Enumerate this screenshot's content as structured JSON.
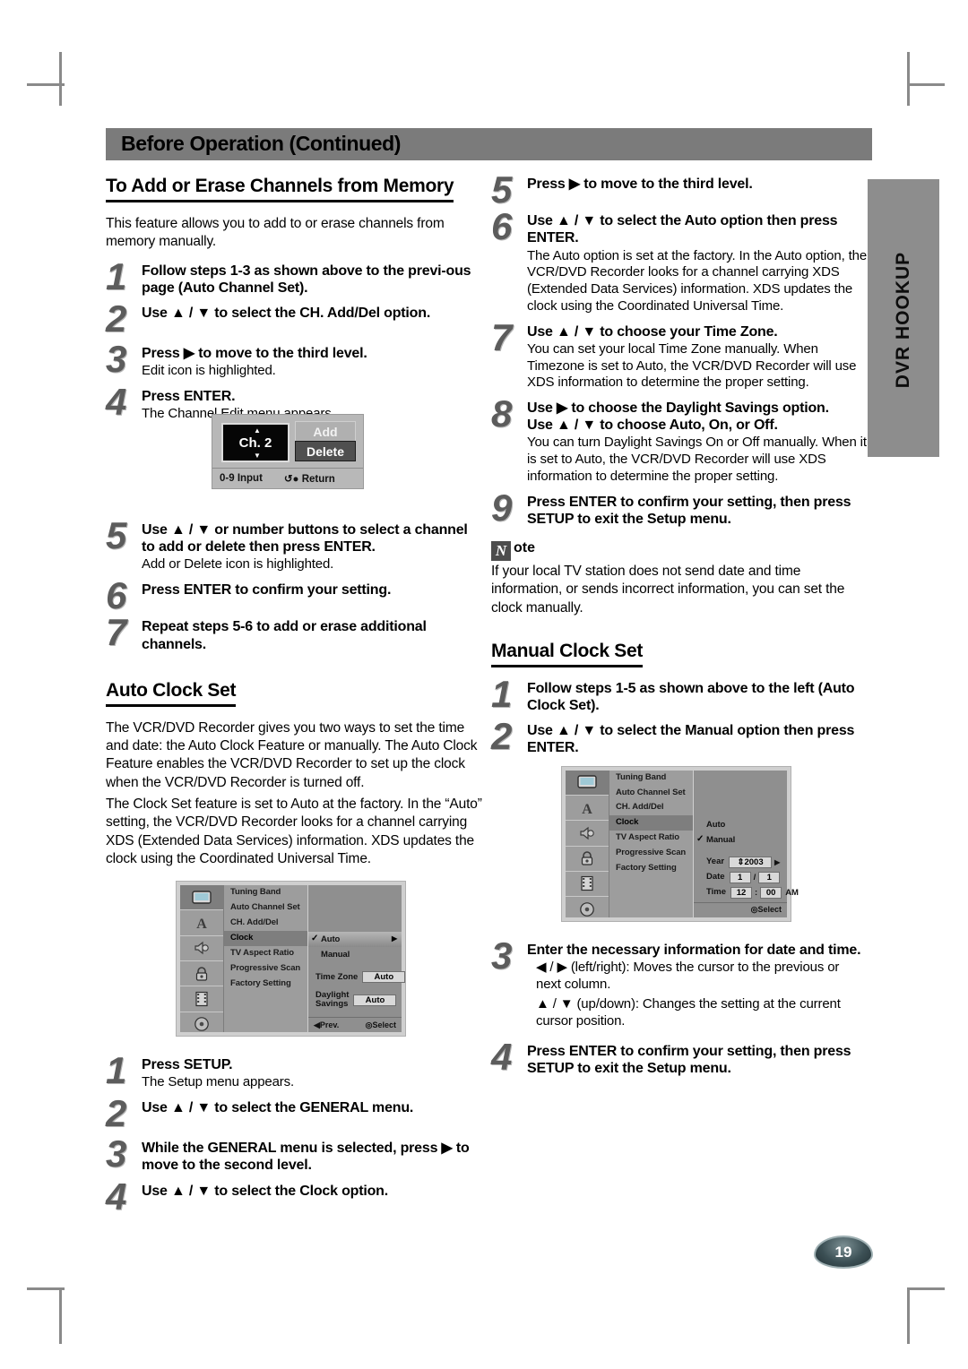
{
  "header": {
    "title": "Before Operation (Continued)"
  },
  "side_tab": {
    "label": "DVR HOOKUP"
  },
  "page_number": "19",
  "left": {
    "section1_title": "To Add or Erase Channels from Memory",
    "intro": "This feature allows you to add to or erase channels from memory manually.",
    "steps": [
      {
        "num": "1",
        "head": "Follow steps 1-3 as shown above to the previ-ous page (Auto Channel Set).",
        "sub": ""
      },
      {
        "num": "2",
        "head": "Use ▲ / ▼ to select the CH. Add/Del option.",
        "sub": ""
      },
      {
        "num": "3",
        "head": "Press ▶ to move to the third level.",
        "sub": "Edit icon is highlighted."
      },
      {
        "num": "4",
        "head": "Press ENTER.",
        "sub": "The Channel Edit menu appears."
      }
    ],
    "chan_edit": {
      "channel": "Ch. 2",
      "add_label": "Add",
      "delete_label": "Delete",
      "footer_left": "0-9 Input",
      "footer_right": "Return"
    },
    "steps2": [
      {
        "num": "5",
        "head": "Use ▲ / ▼ or number buttons to select a channel to add or delete then press ENTER.",
        "sub": "Add or Delete icon is highlighted."
      },
      {
        "num": "6",
        "head": "Press ENTER to confirm your setting.",
        "sub": ""
      },
      {
        "num": "7",
        "head": "Repeat steps 5-6 to add or erase additional channels.",
        "sub": ""
      }
    ],
    "section2_title": "Auto Clock Set",
    "auto_para1": "The VCR/DVD Recorder gives you two ways to set the time and date: the Auto Clock Feature or manually. The Auto Clock Feature enables the VCR/DVD Recorder to set up the clock when the VCR/DVD Recorder is turned off.",
    "auto_para2": "The Clock Set feature is set to Auto at the factory. In the “Auto” setting, the VCR/DVD Recorder looks for a channel carrying XDS (Extended Data Services) information. XDS updates the clock using the Coordinated Universal Time.",
    "osd_auto": {
      "menu_items": [
        "Tuning Band",
        "Auto Channel Set",
        "CH. Add/Del",
        "Clock",
        "TV Aspect Ratio",
        "Progressive Scan",
        "Factory Setting"
      ],
      "selected_menu_item": "Clock",
      "option_auto": "Auto",
      "option_manual": "Manual",
      "timezone_label": "Time Zone",
      "timezone_value": "Auto",
      "daylight_label1": "Daylight",
      "daylight_label2": "Savings",
      "daylight_value": "Auto",
      "bar_prev": "Prev.",
      "bar_select": "Select"
    },
    "steps3": [
      {
        "num": "1",
        "head": "Press SETUP.",
        "sub": "The Setup menu appears."
      },
      {
        "num": "2",
        "head": "Use ▲ / ▼ to select the GENERAL menu.",
        "sub": ""
      },
      {
        "num": "3",
        "head": "While the GENERAL menu is selected, press ▶ to move to the second level.",
        "sub": ""
      },
      {
        "num": "4",
        "head": "Use ▲ / ▼ to select the Clock option.",
        "sub": ""
      }
    ]
  },
  "right": {
    "steps": [
      {
        "num": "5",
        "head": "Press ▶ to move to the third level.",
        "sub": ""
      },
      {
        "num": "6",
        "head": "Use ▲ / ▼ to select the Auto option then press ENTER.",
        "sub": "The Auto option is set at the factory. In the Auto option, the VCR/DVD Recorder looks for a channel carrying XDS (Extended Data Services) information. XDS updates the clock using the Coordinated Universal Time."
      },
      {
        "num": "7",
        "head": "Use ▲ / ▼ to choose your Time Zone.",
        "sub": "You can set your local Time Zone manually. When Timezone is set to Auto, the VCR/DVD Recorder will use XDS information to determine the proper setting."
      },
      {
        "num": "8",
        "head": "Use ▶ to choose the Daylight Savings option.",
        "head2": "Use ▲ / ▼ to choose Auto, On, or Off.",
        "sub": "You can turn Daylight Savings On or Off manually. When it is set to Auto, the VCR/DVD Recorder will use XDS information to determine the proper setting."
      },
      {
        "num": "9",
        "head": "Press ENTER to confirm your setting, then press SETUP to exit the Setup menu.",
        "sub": ""
      }
    ],
    "note_badge": "N",
    "note_word": "ote",
    "note_text": "If your local TV station does not send date and time information, or sends incorrect information, you can set the clock manually.",
    "section_title": "Manual Clock Set",
    "steps2": [
      {
        "num": "1",
        "head": "Follow steps 1-5 as shown above to the left (Auto Clock Set).",
        "sub": ""
      },
      {
        "num": "2",
        "head": "Use ▲ / ▼ to select the Manual option then press ENTER.",
        "sub": ""
      }
    ],
    "osd_manual": {
      "menu_items": [
        "Tuning Band",
        "Auto Channel Set",
        "CH. Add/Del",
        "Clock",
        "TV Aspect Ratio",
        "Progressive Scan",
        "Factory Setting"
      ],
      "selected_menu_item": "Clock",
      "option_auto": "Auto",
      "option_manual": "Manual",
      "year_label": "Year",
      "year_value": "2003",
      "date_label": "Date",
      "date_month": "1",
      "date_day": "1",
      "date_sep": "/",
      "time_label": "Time",
      "time_hour": "12",
      "time_sep": ":",
      "time_min": "00",
      "time_ampm": "AM",
      "bar_select": "Select"
    },
    "steps3": [
      {
        "num": "3",
        "head": "Enter the necessary information for date and time.",
        "sub": "◀ / ▶ (left/right): Moves the cursor to the previous or next column.",
        "sub2": "▲ / ▼ (up/down): Changes the setting at the current cursor position."
      },
      {
        "num": "4",
        "head": "Press ENTER to confirm your setting, then press SETUP to exit the Setup menu.",
        "sub": ""
      }
    ]
  }
}
